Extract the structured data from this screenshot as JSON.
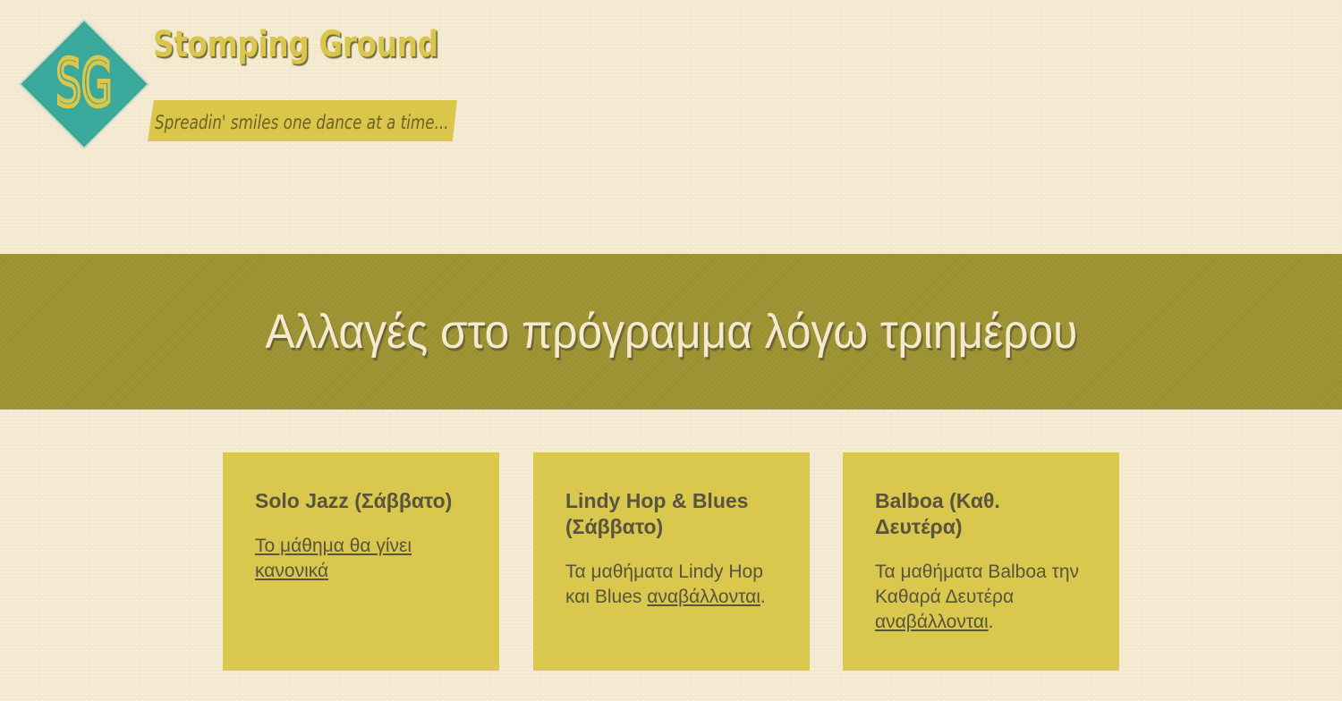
{
  "header": {
    "logo_monogram": "SG",
    "site_title": "Stomping Ground",
    "tagline": "Spreadin' smiles one dance at a time..."
  },
  "colors": {
    "background": "#f4ead0",
    "accent_yellow": "#dac64a",
    "banner_olive": "#9f9534",
    "logo_teal": "#3aa89a",
    "text_dark": "#57543f"
  },
  "banner": {
    "title": "Αλλαγές στο πρόγραμμα λόγω τριημέρου"
  },
  "cards": [
    {
      "title": "Solo Jazz (Σάββατο)",
      "text_before": "",
      "link": "Το μάθημα θα γίνει κανονικά",
      "text_after": ""
    },
    {
      "title": "Lindy Hop & Blues (Σάββατο)",
      "text_before": "Τα μαθήματα Lindy Hop και Blues ",
      "link": "αναβάλλονται",
      "text_after": "."
    },
    {
      "title": "Balboa (Καθ. Δευτέρα)",
      "text_before": "Τα μαθήματα Balboa την Καθαρά Δευτέρα ",
      "link": "αναβάλλονται",
      "text_after": "."
    }
  ]
}
